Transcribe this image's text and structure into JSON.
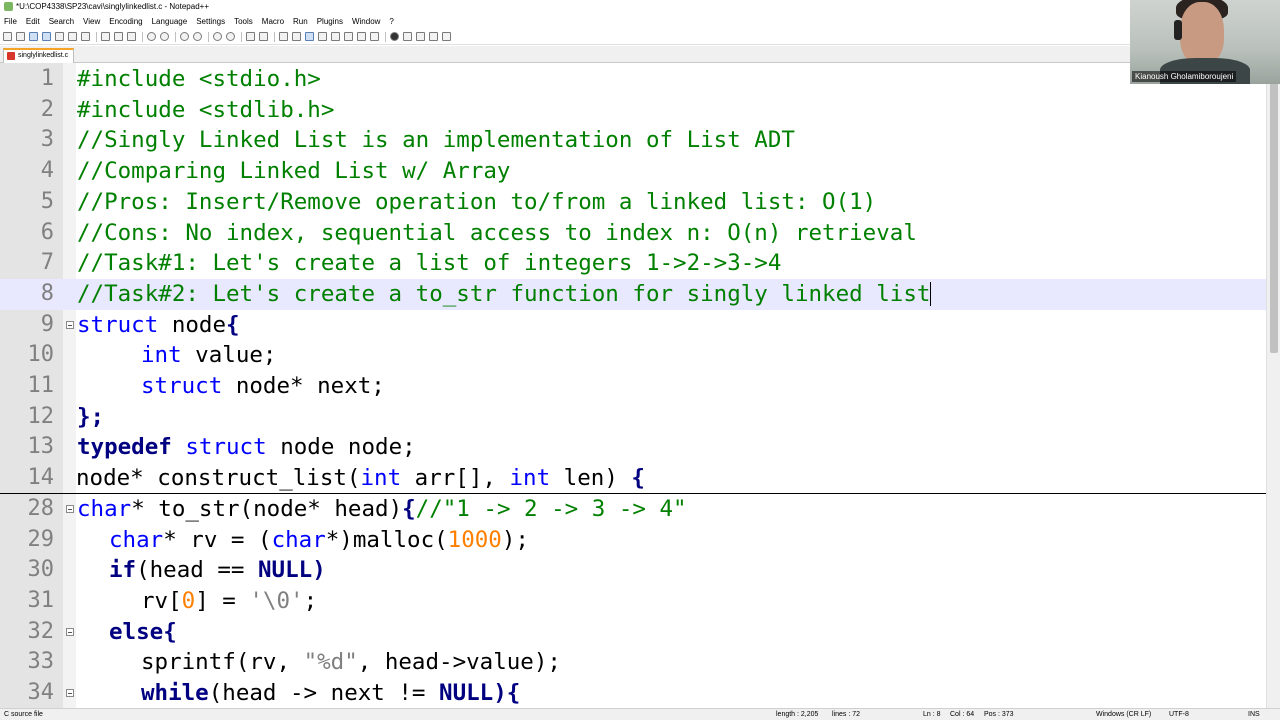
{
  "window": {
    "title": "*U:\\COP4338\\SP23\\cavi\\singlylinkedlist.c - Notepad++"
  },
  "menu": [
    "File",
    "Edit",
    "Search",
    "View",
    "Encoding",
    "Language",
    "Settings",
    "Tools",
    "Macro",
    "Run",
    "Plugins",
    "Window",
    "?"
  ],
  "tabs": [
    {
      "label": "singlylinkedlist.c"
    }
  ],
  "editor": {
    "current_line": "8",
    "lines": [
      {
        "num": "1"
      },
      {
        "num": "2"
      },
      {
        "num": "3"
      },
      {
        "num": "4"
      },
      {
        "num": "5"
      },
      {
        "num": "6"
      },
      {
        "num": "7"
      },
      {
        "num": "8"
      },
      {
        "num": "9"
      },
      {
        "num": "10"
      },
      {
        "num": "11"
      },
      {
        "num": "12"
      },
      {
        "num": "13"
      },
      {
        "num": "14"
      },
      {
        "num": "28"
      },
      {
        "num": "29"
      },
      {
        "num": "30"
      },
      {
        "num": "31"
      },
      {
        "num": "32"
      },
      {
        "num": "33"
      },
      {
        "num": "34"
      }
    ],
    "t": {
      "include_kw": "#include",
      "stdio": " <stdio.h>",
      "stdlib": " <stdlib.h>",
      "c3": "//Singly Linked List is an implementation of List ADT",
      "c4": "//Comparing Linked List w/ Array",
      "c5": "//Pros: Insert/Remove operation to/from a linked list: O(1)",
      "c6": "//Cons: No index, sequential access to index n: O(n) retrieval",
      "c7": "//Task#1: Let's create a list of integers 1->2->3->4",
      "c8": "//Task#2: Let's create a to_str function for singly linked list",
      "struct": "struct",
      "node": " node",
      "lbrace": "{",
      "rbrace": "}",
      "int": "int",
      "value": " value;",
      "nodeptr_next": " node* next;",
      "semi": ";",
      "typedef": "typedef",
      "node_node": " node node;",
      "construct_a": "node* construct_list(",
      "arr": " arr[], ",
      "len": " len) ",
      "char": "char",
      "to_str_sig": "* to_str(node* head)",
      "c28": "//\"1 -> 2 -> 3 -> 4\"",
      "rv_decl": "* rv = (",
      "rv_cast": "*)malloc(",
      "n1000": "1000",
      "close_semi": ");",
      "if": "if",
      "head_eq": "(head == ",
      "null": "NULL",
      "rparen": ")",
      "rv_idx": "rv[",
      "zero": "0",
      "rv_assign": "] = ",
      "nulchar": "'\\0'",
      "else": "else",
      "sprintf_a": "sprintf(rv, ",
      "fmt": "\"%d\"",
      "sprintf_b": ", head->value);",
      "while": "while",
      "while_cond": "(head -> next != ",
      "rparen_brace": "){"
    }
  },
  "webcam": {
    "name": "Kianoush Gholamiboroujeni"
  },
  "status": {
    "file_type": "C source file",
    "length": "length : 2,205",
    "lines": "lines : 72",
    "ln": "Ln : 8",
    "col": "Col : 64",
    "pos": "Pos : 373",
    "eol": "Windows (CR LF)",
    "encoding": "UTF-8",
    "mode": "INS"
  }
}
